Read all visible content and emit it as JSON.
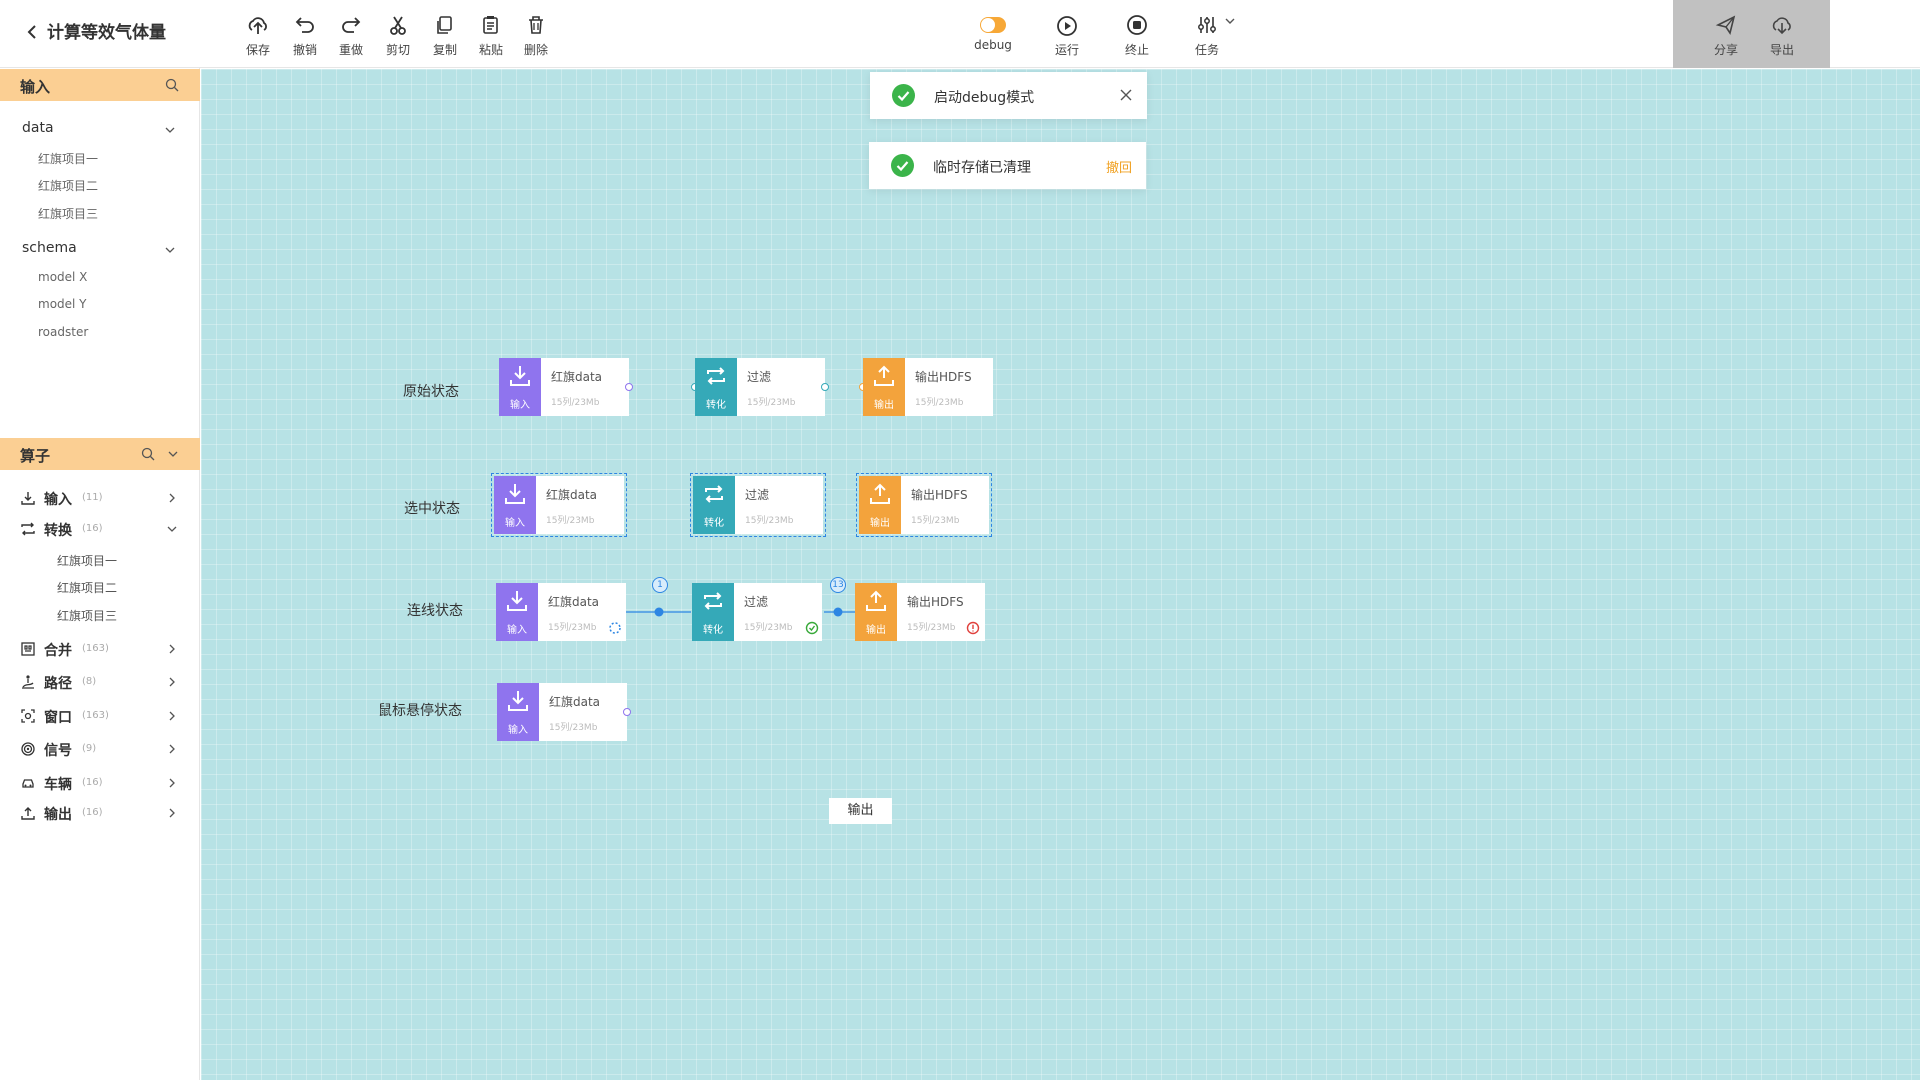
{
  "header": {
    "title": "计算等效气体量",
    "toolbar": {
      "save": "保存",
      "undo": "撤销",
      "redo": "重做",
      "cut": "剪切",
      "copy": "复制",
      "paste": "粘贴",
      "delete": "删除",
      "debug": "debug",
      "run": "运行",
      "stop": "终止",
      "task": "任务",
      "share": "分享",
      "export": "导出"
    }
  },
  "sidebar": {
    "input_section": {
      "title": "输入",
      "groups": [
        {
          "name": "data",
          "items": [
            "红旗项目一",
            "红旗项目二",
            "红旗项目三"
          ]
        },
        {
          "name": "schema",
          "items": [
            "model X",
            "model Y",
            "roadster"
          ]
        }
      ]
    },
    "operator_section": {
      "title": "算子",
      "ops": [
        {
          "name": "输入",
          "count": "(11)"
        },
        {
          "name": "转换",
          "count": "(16)",
          "children": [
            "红旗项目一",
            "红旗项目二",
            "红旗项目三"
          ]
        },
        {
          "name": "合并",
          "count": "(163)"
        },
        {
          "name": "路径",
          "count": "(8)"
        },
        {
          "name": "窗口",
          "count": "(163)"
        },
        {
          "name": "信号",
          "count": "(9)"
        },
        {
          "name": "车辆",
          "count": "(16)"
        },
        {
          "name": "输出",
          "count": "(16)"
        }
      ]
    }
  },
  "canvas": {
    "toasts": [
      {
        "message": "启动debug模式"
      },
      {
        "message": "临时存储已清理",
        "action": "撤回"
      }
    ],
    "rows": [
      "原始状态",
      "选中状态",
      "连线状态",
      "鼠标悬停状态"
    ],
    "node_types": {
      "input": {
        "title": "红旗data",
        "tag": "输入",
        "color": "#8f74ee"
      },
      "transform": {
        "title": "过滤",
        "tag": "转化",
        "color": "#35a9b8"
      },
      "output": {
        "title": "输出HDFS",
        "tag": "输出",
        "color": "#f3a33c"
      }
    },
    "node_stats": "15列/23Mb",
    "edge_counts": [
      "1",
      "13"
    ],
    "hover_tooltip": "输出"
  }
}
